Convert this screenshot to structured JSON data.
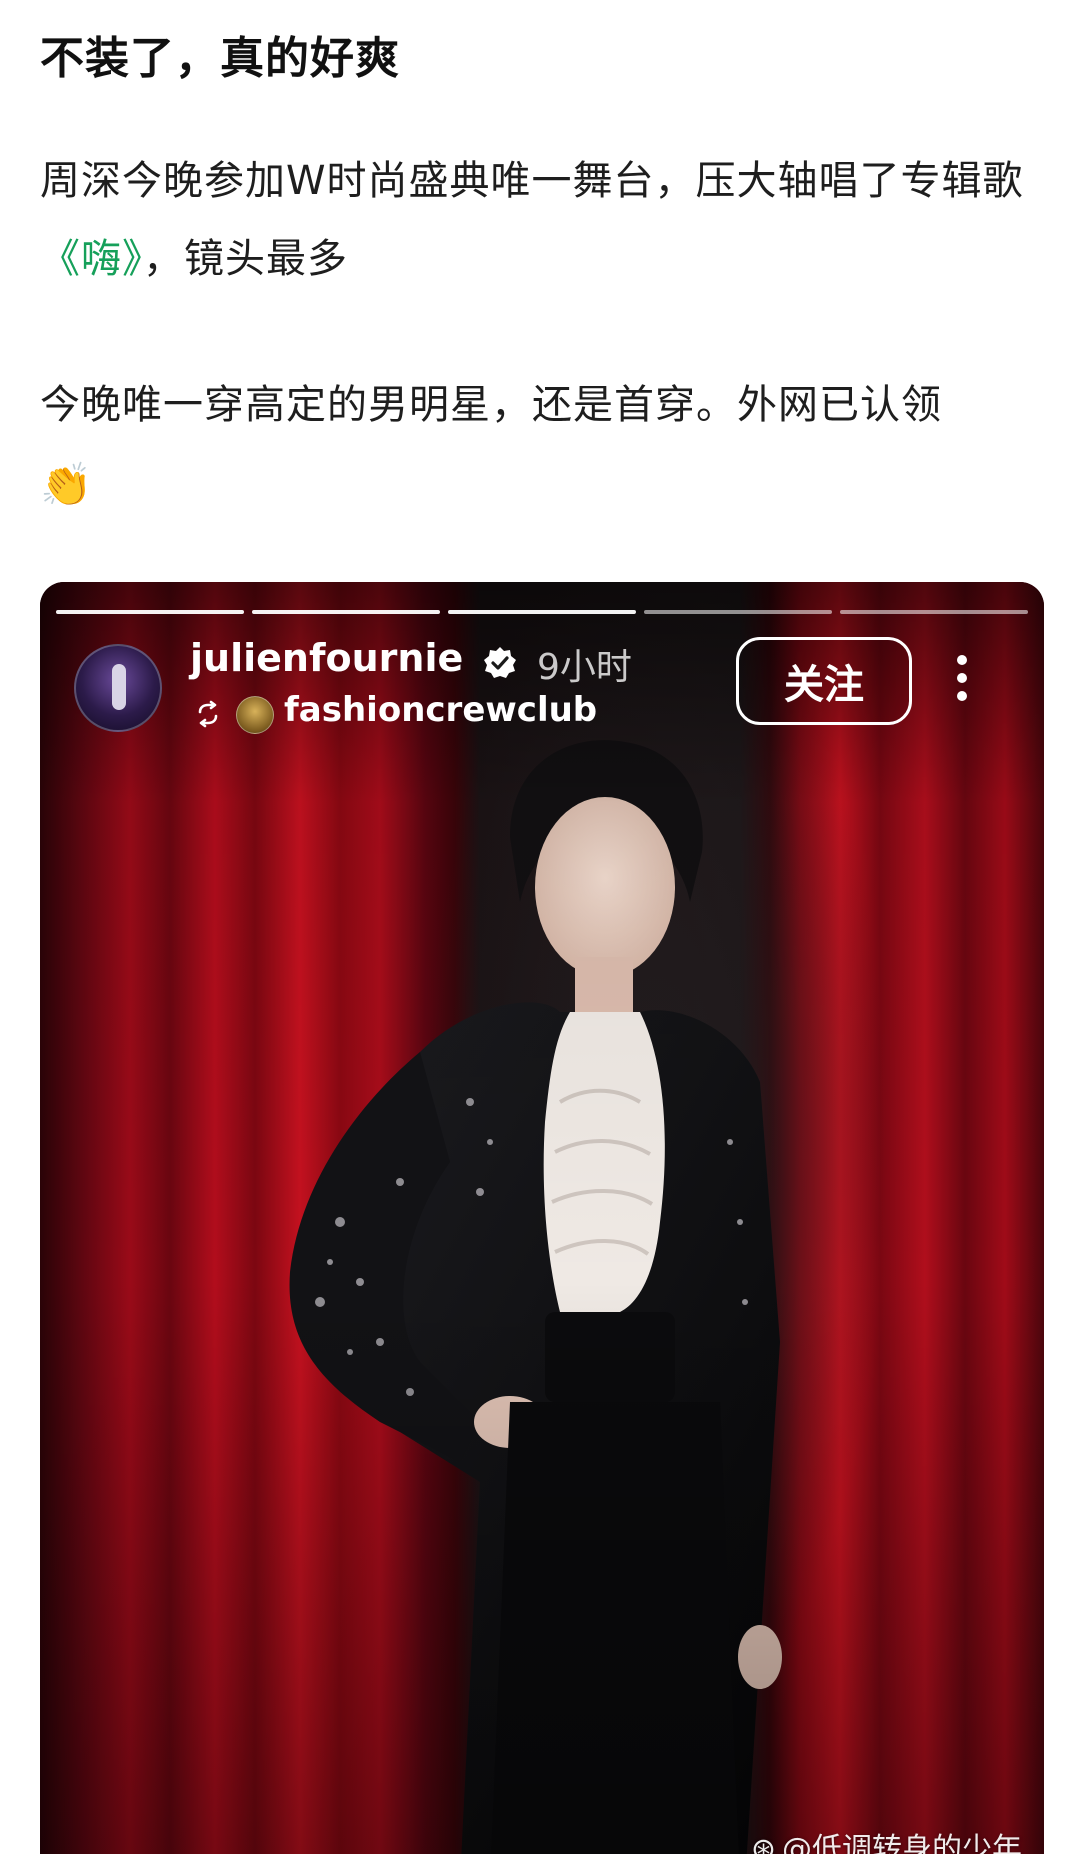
{
  "post": {
    "title": "不装了，真的好爽",
    "para1_before": "周深今晚参加W时尚盛典唯一舞台，压大轴唱了专辑歌",
    "song_link": "《嗨》",
    "para1_after": "，镜头最多",
    "para2": "今晚唯一穿高定的男明星，还是首穿。外网已认领",
    "para2_emoji": "👏"
  },
  "story": {
    "progress_segments": 5,
    "active_segment": 3,
    "username": "julienfournie",
    "verified_icon": "verified-badge-icon",
    "time": "9小时",
    "reposted_account": "fashioncrewclub",
    "follow_label": "关注",
    "more_icon": "vertical-ellipsis-icon"
  },
  "watermark": {
    "logo_glyph": "⊛",
    "text": "@低调转身的少年"
  },
  "colors": {
    "link_green": "#16a05a",
    "curtain_red": "#b20d1c",
    "text_dark": "#1e1e1e"
  }
}
